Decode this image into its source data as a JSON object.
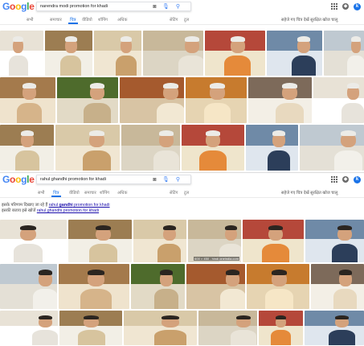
{
  "top": {
    "logo": [
      "G",
      "o",
      "o",
      "g",
      "l",
      "e"
    ],
    "logo_colors": [
      "#4285f4",
      "#ea4335",
      "#fbbc05",
      "#4285f4",
      "#34a853",
      "#ea4335"
    ],
    "query": "narendra modi promotion for khadi",
    "tabs": [
      "सभी",
      "समाचार",
      "चित्र",
      "वीडियो",
      "शॉपिंग",
      "अधिक"
    ],
    "active_tab": "चित्र",
    "settings": "सेटिंग",
    "tools": "टूल",
    "right_links": "सहेजे गए चित्र देखें   सुरक्षित खोज चालू",
    "avatar_letter": "k"
  },
  "bottom": {
    "logo": [
      "G",
      "o",
      "o",
      "g",
      "l",
      "e"
    ],
    "query": "rahul ghandhi promotion for khadi",
    "tabs": [
      "सभी",
      "चित्र",
      "वीडियो",
      "समाचार",
      "शॉपिंग",
      "अधिक"
    ],
    "active_tab": "चित्र",
    "settings": "सेटिंग",
    "tools": "टूल",
    "right_links": "सहेजे गए चित्र देखें   सुरक्षित खोज चालू",
    "avatar_letter": "k",
    "suggest_line1_prefix": "इसके परिणाम दिखाए जा रहे हैं",
    "suggest_line1_link_a": "rahul ",
    "suggest_line1_link_b": "gandhi",
    "suggest_line1_link_c": " promotion for khadi",
    "suggest_line2_prefix": "इसकी बजाय इसे खोजें",
    "suggest_line2_link": "rahul ghandhi promotion for khadi",
    "image_badge": "600 × 450 - hindi.oneindia.com"
  },
  "colors": {
    "accent": "#1a73e8",
    "link": "#1a0dab"
  }
}
